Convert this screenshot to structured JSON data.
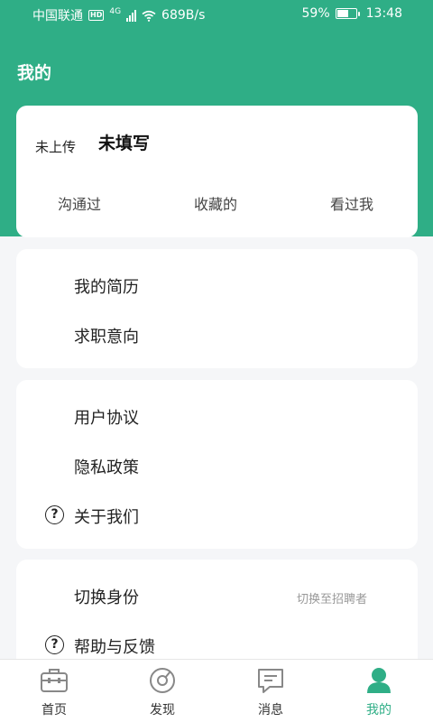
{
  "status_bar": {
    "carrier": "中国联通",
    "hd": "HD",
    "network": "4G",
    "speed": "689B/s",
    "battery": "59%",
    "battery_level": 0.59,
    "time": "13:48"
  },
  "header": {
    "title": "我的"
  },
  "profile": {
    "upload_status": "未上传",
    "name": "未填写",
    "stats": [
      "沟通过",
      "收藏的",
      "看过我"
    ]
  },
  "group1": {
    "items": [
      {
        "label": "我的简历"
      },
      {
        "label": "求职意向"
      }
    ]
  },
  "group2": {
    "items": [
      {
        "label": "用户协议"
      },
      {
        "label": "隐私政策"
      },
      {
        "label": "关于我们",
        "icon": "help-circle-icon"
      }
    ]
  },
  "group3": {
    "items": [
      {
        "label": "切换身份",
        "hint": "切换至招聘者"
      },
      {
        "label": "帮助与反馈",
        "icon": "help-circle-icon"
      }
    ]
  },
  "tabbar": {
    "items": [
      {
        "label": "首页",
        "icon": "briefcase-icon"
      },
      {
        "label": "发现",
        "icon": "discover-icon"
      },
      {
        "label": "消息",
        "icon": "message-icon"
      },
      {
        "label": "我的",
        "icon": "user-icon"
      }
    ],
    "active_index": 3
  },
  "colors": {
    "accent": "#2fae86",
    "background": "#f5f6f8",
    "icon_gray": "#888888"
  }
}
